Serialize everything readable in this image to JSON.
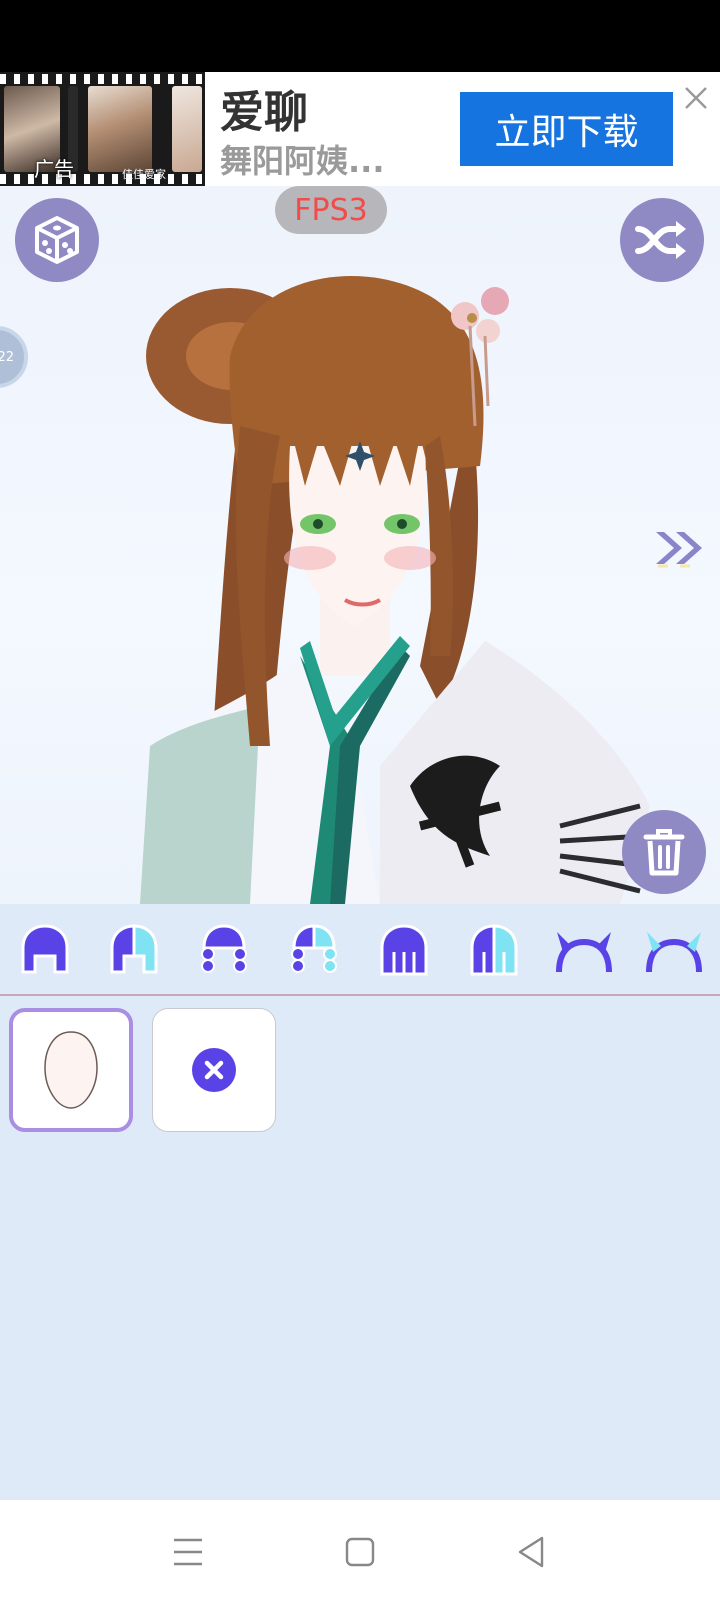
{
  "ad": {
    "tag": "广告",
    "watermark": "佳佳爱家",
    "title": "爱聊",
    "subtitle": "舞阳阿姨...",
    "cta": "立即下载"
  },
  "overlay": {
    "fps": "FPS3",
    "side_badge": "22"
  },
  "toolbar": {
    "tools": [
      "hair-front-icon",
      "hair-front-split-icon",
      "hair-braid-icon",
      "hair-braid-split-icon",
      "hair-long-icon",
      "hair-long-split-icon",
      "horns-icon",
      "horns-split-icon"
    ]
  },
  "panel": {
    "items": [
      "face-shape-option",
      "none-option"
    ],
    "selected_index": 0
  },
  "colors": {
    "accent": "#5a43e6",
    "accent_light": "#7fe3f3",
    "button": "#8f89c4",
    "ad_button": "#1674e0"
  }
}
